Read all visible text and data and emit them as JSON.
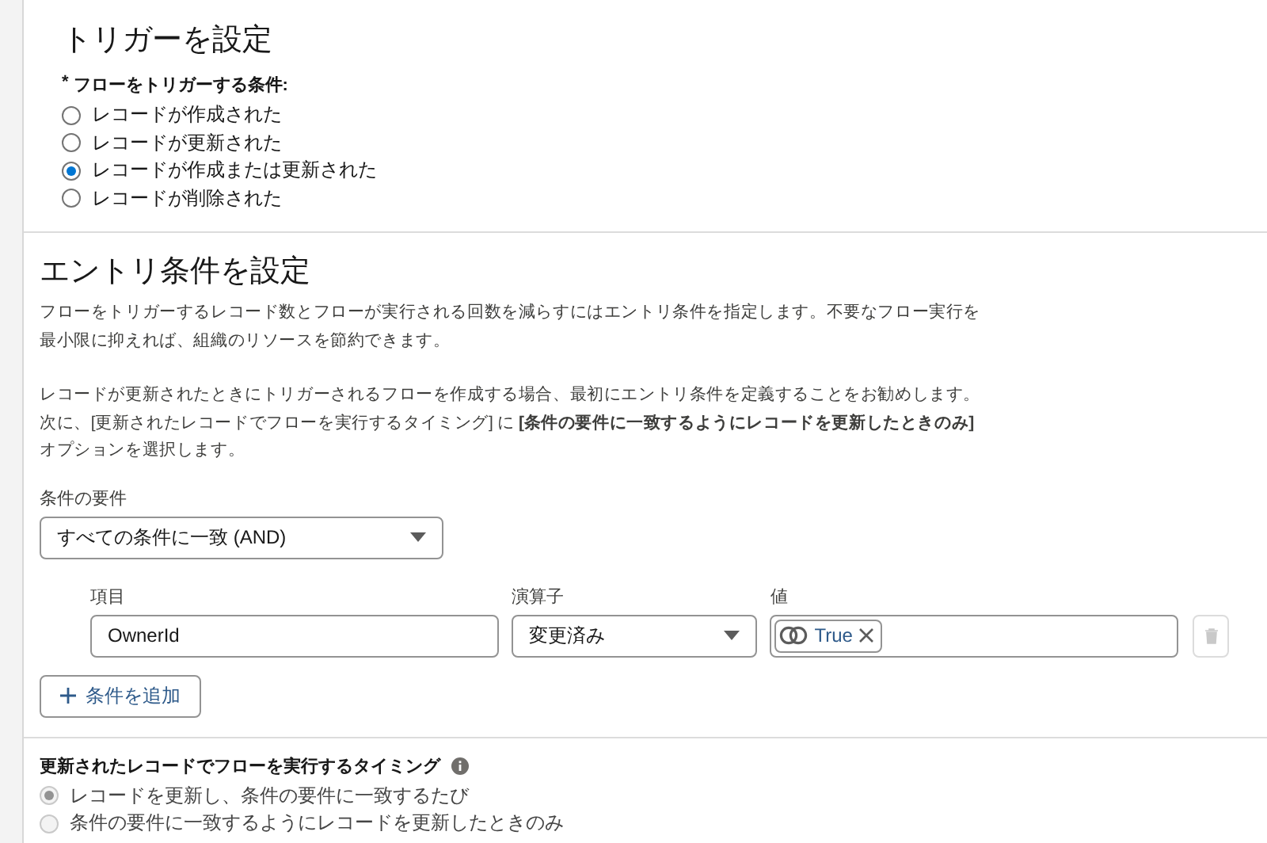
{
  "trigger_section": {
    "title": "トリガーを設定",
    "required_mark": "*",
    "question": "フローをトリガーする条件:",
    "options": [
      {
        "label": "レコードが作成された",
        "selected": false
      },
      {
        "label": "レコードが更新された",
        "selected": false
      },
      {
        "label": "レコードが作成または更新された",
        "selected": true
      },
      {
        "label": "レコードが削除された",
        "selected": false
      }
    ]
  },
  "entry_section": {
    "title": "エントリ条件を設定",
    "paragraphs": [
      "フローをトリガーするレコード数とフローが実行される回数を減らすにはエントリ条件を指定します。不要なフロー実行を最小限に抑えれば、組織のリソースを節約できます。",
      "レコードが更新されたときにトリガーされるフローを作成する場合、最初にエントリ条件を定義することをお勧めします。次に、[更新されたレコードでフローを実行するタイミング] に **[条件の要件に一致するようにレコードを更新したときのみ]** オプションを選択します。"
    ],
    "requirement": {
      "label": "条件の要件",
      "value": "すべての条件に一致 (AND)"
    },
    "conditions": [
      {
        "field_label": "項目",
        "field": "OwnerId",
        "operator_label": "演算子",
        "operator": "変更済み",
        "value_label": "値",
        "value_pill": "True"
      }
    ],
    "add_button": "条件を追加",
    "timing": {
      "label": "更新されたレコードでフローを実行するタイミング",
      "options": [
        {
          "label": "レコードを更新し、条件の要件に一致するたび",
          "selected": true,
          "disabled": true
        },
        {
          "label": "条件の要件に一致するようにレコードを更新したときのみ",
          "selected": false,
          "disabled": true
        }
      ]
    }
  }
}
